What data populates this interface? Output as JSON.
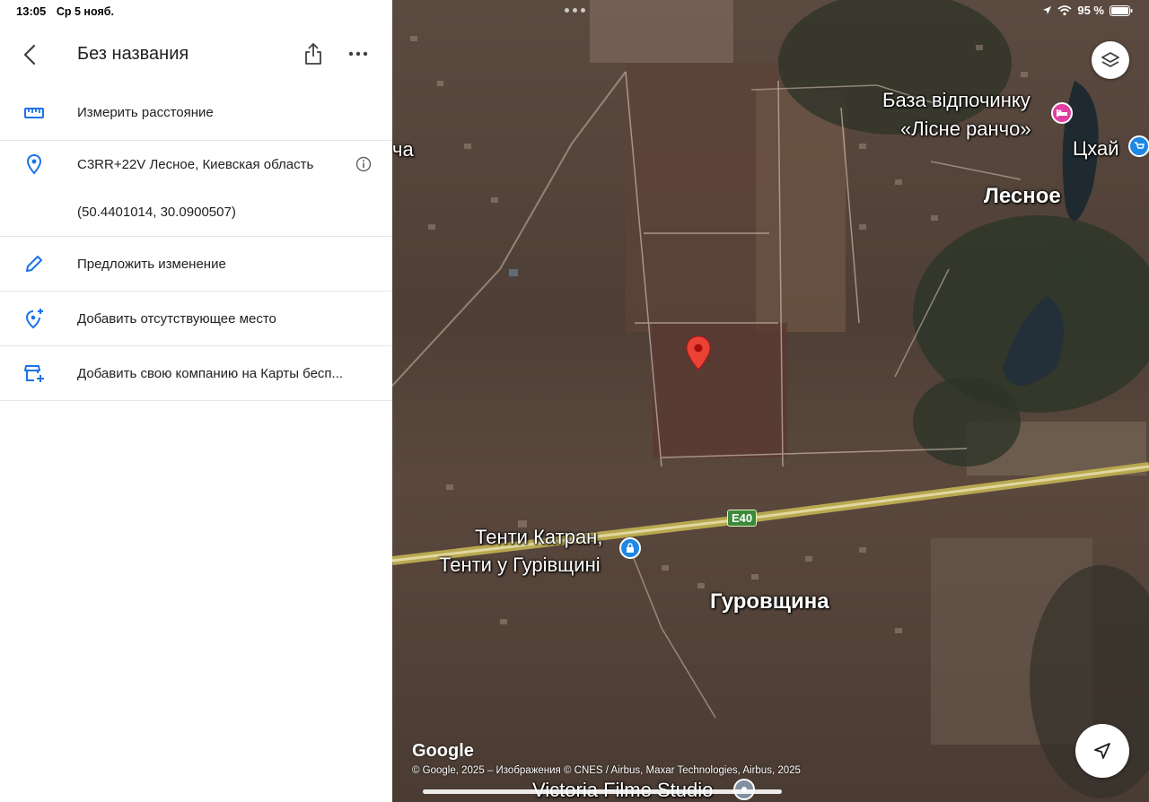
{
  "status_bar": {
    "time": "13:05",
    "date": "Ср 5 нояб.",
    "battery": "95 %"
  },
  "panel": {
    "title": "Без названия",
    "rows": [
      {
        "label": "Измерить расстояние"
      },
      {
        "label": "C3RR+22V Лесное, Киевская область",
        "sub": "(50.4401014, 30.0900507)"
      },
      {
        "label": "Предложить изменение"
      },
      {
        "label": "Добавить отсутствующее место"
      },
      {
        "label": "Добавить свою компанию на Карты бесп..."
      }
    ]
  },
  "map": {
    "labels": {
      "baza_line1": "База відпочинку",
      "baza_line2": "«Лісне ранчо»",
      "tshai": "Цхай",
      "lesnoe": "Лесное",
      "cha": "ча",
      "tenti_line1": "Тенти Катран,",
      "tenti_line2": "Тенти у Гурівщині",
      "gurovshchina": "Гуровщина",
      "victoria": "Victoria Filme Studio",
      "road": "E40"
    },
    "google_logo": "Google",
    "attribution": "© Google, 2025 – Изображения © CNES / Airbus, Maxar Technologies, Airbus, 2025"
  },
  "colors": {
    "pin_red": "#ea4335",
    "accent_blue": "#1a73e8",
    "poi_pink": "#e040a0",
    "poi_blue": "#1e88e5"
  }
}
